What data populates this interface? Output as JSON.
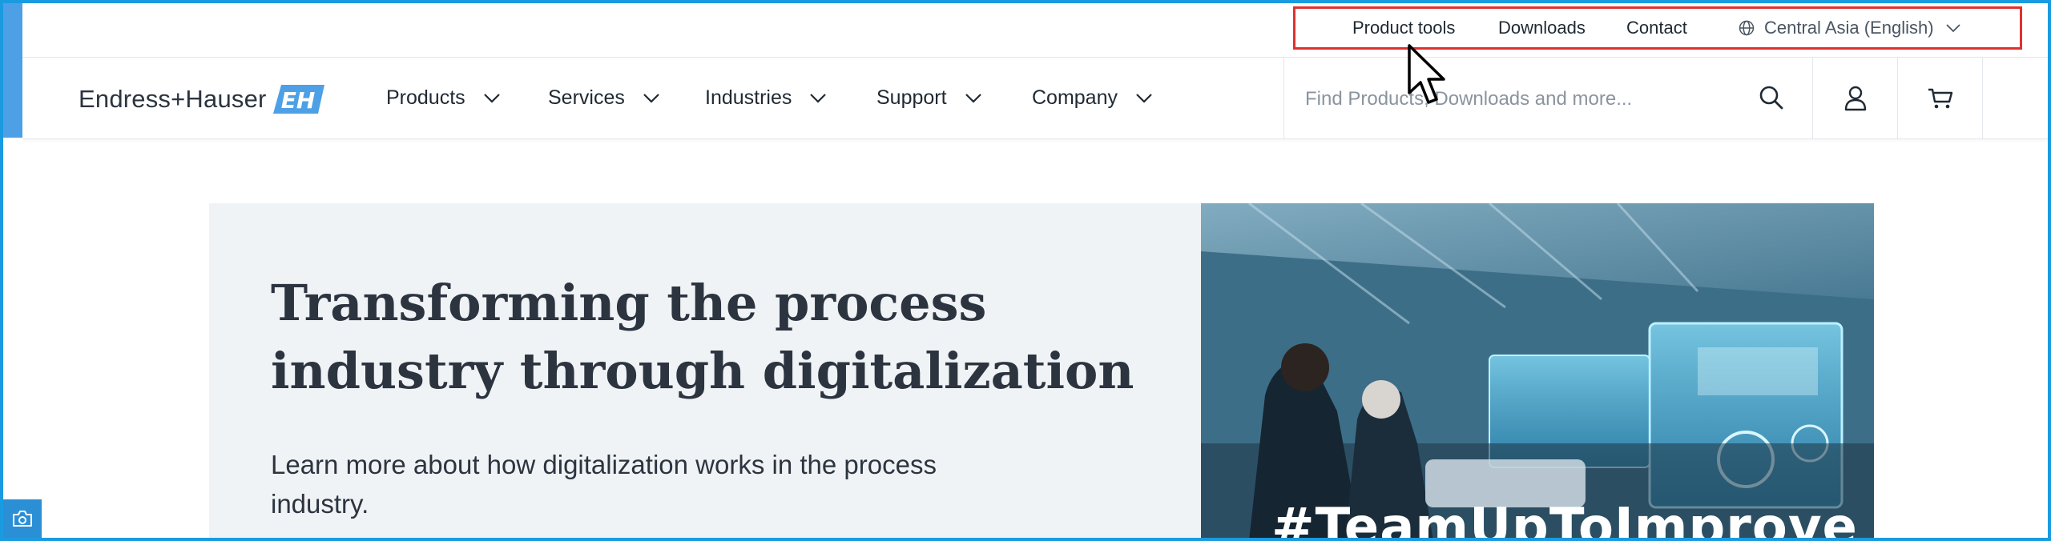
{
  "utility": {
    "product_tools": "Product tools",
    "downloads": "Downloads",
    "contact": "Contact",
    "region": "Central Asia (English)"
  },
  "brand": {
    "name": "Endress+Hauser",
    "mark": "EH",
    "color": "#4da0e6"
  },
  "nav": {
    "products": "Products",
    "services": "Services",
    "industries": "Industries",
    "support": "Support",
    "company": "Company"
  },
  "search": {
    "placeholder": "Find Products, Downloads and more..."
  },
  "hero": {
    "title": "Transforming the process industry through digitalization",
    "subtitle": "Learn more about how digitalization works in the process industry.",
    "image_caption": "#TeamUpToImprove"
  },
  "icons": {
    "globe": "globe-icon",
    "search": "search-icon",
    "user": "user-icon",
    "cart": "cart-icon",
    "camera": "camera-icon"
  },
  "colors": {
    "accent": "#1a9be0",
    "highlight_box": "#e0312f",
    "hero_panel": "#f0f3f5",
    "text": "#1f2933"
  }
}
